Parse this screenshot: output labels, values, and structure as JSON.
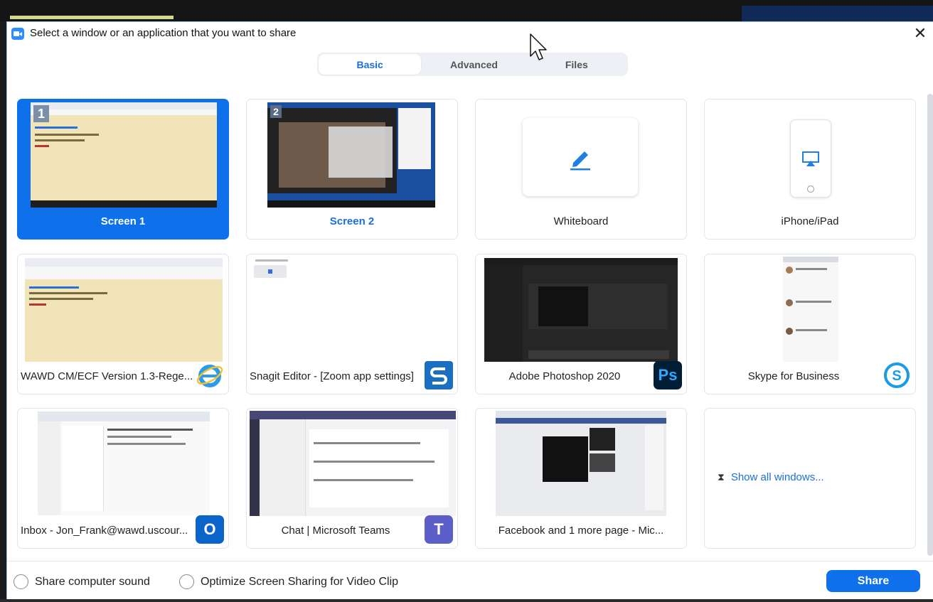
{
  "window": {
    "title": "Select a window or an application that you want to share",
    "close_glyph": "✕"
  },
  "tabs": [
    {
      "label": "Basic",
      "active": true
    },
    {
      "label": "Advanced",
      "active": false
    },
    {
      "label": "Files",
      "active": false
    }
  ],
  "tiles": [
    {
      "label": "Screen 1",
      "badge": "1",
      "selected": true
    },
    {
      "label": "Screen 2",
      "badge": "2"
    },
    {
      "label": "Whiteboard",
      "icon": "pencil-icon"
    },
    {
      "label": "iPhone/iPad",
      "icon": "airplay-icon"
    },
    {
      "label": "WAWD CM/ECF Version 1.3-Rege...",
      "icon": "internet-explorer-icon"
    },
    {
      "label": "Snagit Editor - [Zoom app settings]",
      "icon": "snagit-icon"
    },
    {
      "label": "Adobe Photoshop 2020",
      "icon": "photoshop-icon",
      "icon_text": "Ps"
    },
    {
      "label": "Skype for Business",
      "icon": "skype-icon"
    },
    {
      "label": "Inbox - Jon_Frank@wawd.uscour...",
      "icon": "outlook-icon",
      "icon_text": "O"
    },
    {
      "label": "Chat | Microsoft Teams",
      "icon": "teams-icon",
      "icon_text": "T"
    },
    {
      "label": "Facebook and 1 more page - Mic..."
    },
    {
      "label": "Show all windows...",
      "icon": "expand-icon"
    }
  ],
  "footer": {
    "share_sound_label": "Share computer sound",
    "optimize_label": "Optimize Screen Sharing for Video Clip",
    "share_button": "Share"
  },
  "colors": {
    "accent": "#0e71eb",
    "link": "#1c6fd6",
    "photoshop": "#001e36",
    "outlook": "#0a64c9",
    "teams": "#5b5fc7"
  }
}
